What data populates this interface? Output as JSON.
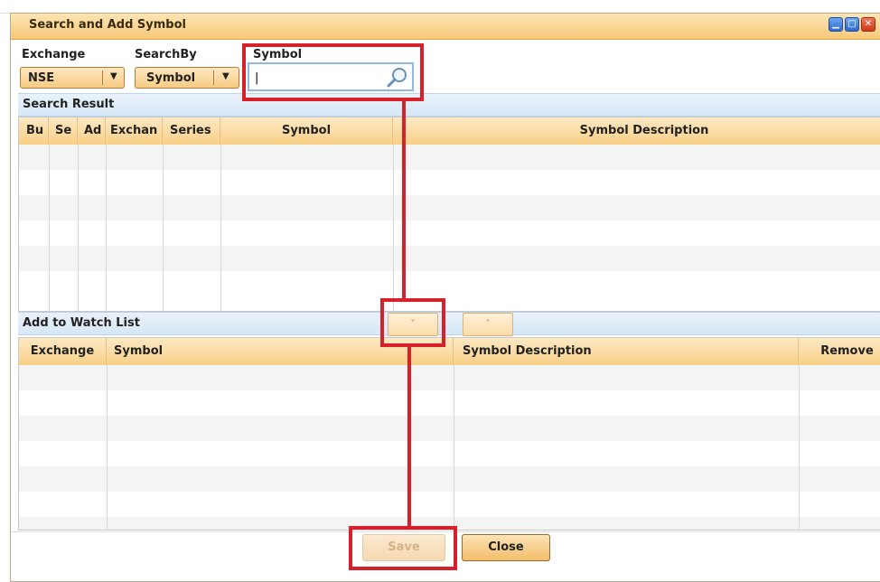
{
  "window": {
    "title": "Search and Add Symbol"
  },
  "filters": {
    "exchange_label": "Exchange",
    "exchange_value": "NSE",
    "searchby_label": "SearchBy",
    "searchby_value": "Symbol",
    "symbol_label": "Symbol",
    "symbol_value": "|",
    "symbol_placeholder": ""
  },
  "search_result": {
    "title": "Search Result",
    "columns": [
      "Bu",
      "Se",
      "Ad",
      "Exchan",
      "Series",
      "Symbol",
      "Symbol Description"
    ],
    "rows": 6
  },
  "watch_list": {
    "title": "Add to Watch List",
    "move_down_label": "˅",
    "move_up_label": "˄",
    "columns": [
      "Exchange",
      "Symbol",
      "Symbol Description",
      "Remove"
    ],
    "rows": 7
  },
  "footer": {
    "save_label": "Save",
    "close_label": "Close"
  },
  "colors": {
    "annotation": "#d8202a",
    "header_gradient_top": "#fde9c4",
    "header_gradient_bottom": "#f8cf86",
    "section_bg": "#d6e7f7"
  },
  "icons": [
    "search-icon",
    "minimize-icon",
    "maximize-icon",
    "close-icon",
    "dropdown-arrow-icon"
  ]
}
